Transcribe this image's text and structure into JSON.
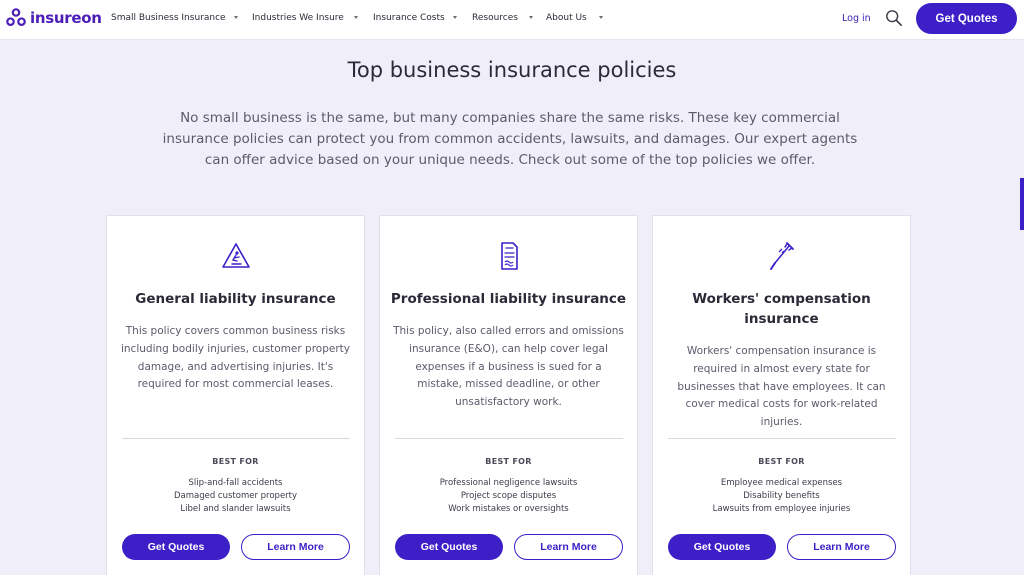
{
  "colors": {
    "brand": "#3d1fc7",
    "background": "#f0eff9",
    "text_dark": "#2a2a38",
    "text_muted": "#5b5b6c"
  },
  "header": {
    "logo_text": "insureon",
    "nav": [
      {
        "label": "Small Business Insurance",
        "icon": "chevron-down-icon"
      },
      {
        "label": "Industries We Insure",
        "icon": "chevron-down-icon"
      },
      {
        "label": "Insurance Costs",
        "icon": "chevron-down-icon"
      },
      {
        "label": "Resources",
        "icon": "chevron-down-icon"
      },
      {
        "label": "About Us",
        "icon": "chevron-down-icon"
      }
    ],
    "login_label": "Log in",
    "search_icon": "search-icon",
    "cta_label": "Get Quotes"
  },
  "main": {
    "title": "Top business insurance policies",
    "intro": "No small business is the same, but many companies share the same risks. These key commercial insurance policies can protect you from common accidents, lawsuits, and damages. Our expert agents can offer advice based on your unique needs. Check out some of the top policies we offer.",
    "best_for_label": "BEST FOR",
    "cards": [
      {
        "icon": "slip-hazard-icon",
        "title": "General liability insurance",
        "description": "This policy covers common business risks including bodily injuries, customer property damage, and advertising injuries. It's required for most commercial leases.",
        "best_for": [
          "Slip-and-fall accidents",
          "Damaged customer property",
          "Libel and slander lawsuits"
        ],
        "primary_label": "Get Quotes",
        "secondary_label": "Learn More"
      },
      {
        "icon": "document-icon",
        "title": "Professional liability insurance",
        "description": "This policy, also called errors and omissions insurance (E&O), can help cover legal expenses if a business is sued for a mistake, missed deadline, or other unsatisfactory work.",
        "best_for": [
          "Professional negligence lawsuits",
          "Project scope disputes",
          "Work mistakes or oversights"
        ],
        "primary_label": "Get Quotes",
        "secondary_label": "Learn More"
      },
      {
        "icon": "crutch-icon",
        "title": "Workers' compensation insurance",
        "description": "Workers' compensation insurance is required in almost every state for businesses that have employees. It can cover medical costs for work-related injuries.",
        "best_for": [
          "Employee medical expenses",
          "Disability benefits",
          "Lawsuits from employee injuries"
        ],
        "primary_label": "Get Quotes",
        "secondary_label": "Learn More"
      }
    ]
  }
}
